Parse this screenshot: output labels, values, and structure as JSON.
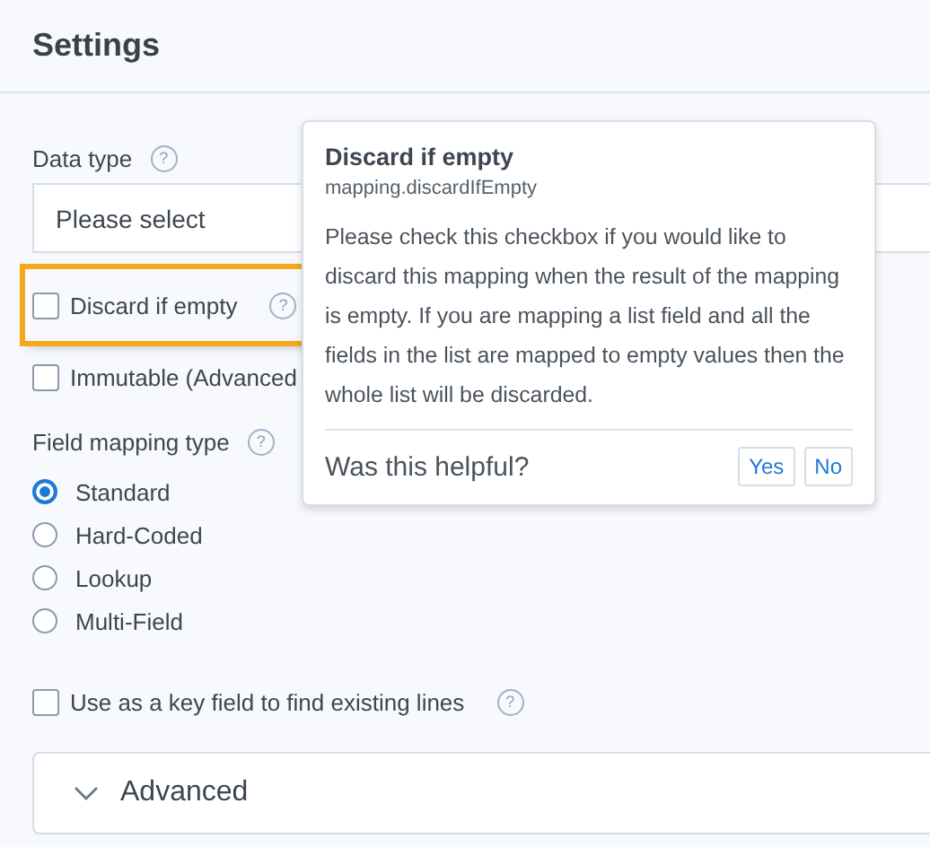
{
  "header": {
    "title": "Settings"
  },
  "data_type": {
    "label": "Data type",
    "help": "?",
    "placeholder": "Please select"
  },
  "checkboxes": [
    {
      "label": "Discard if empty",
      "help": "?",
      "checked": false,
      "highlighted": true
    },
    {
      "label": "Immutable (Advanced",
      "checked": false,
      "highlighted": false
    }
  ],
  "field_mapping": {
    "label": "Field mapping type",
    "help": "?",
    "options": [
      {
        "label": "Standard",
        "selected": true
      },
      {
        "label": "Hard-Coded",
        "selected": false
      },
      {
        "label": "Lookup",
        "selected": false
      },
      {
        "label": "Multi-Field",
        "selected": false
      }
    ]
  },
  "key_field": {
    "label": "Use as a key field to find existing lines",
    "help": "?",
    "checked": false
  },
  "advanced": {
    "label": "Advanced",
    "expanded": false
  },
  "popover": {
    "title": "Discard if empty",
    "path": "mapping.discardIfEmpty",
    "body": "Please check this checkbox if you would like to discard this mapping when the result of the mapping is empty. If you are mapping a list field and all the fields in the list are mapped to empty values then the whole list will be discarded.",
    "question": "Was this helpful?",
    "buttons": [
      "Yes",
      "No"
    ]
  }
}
